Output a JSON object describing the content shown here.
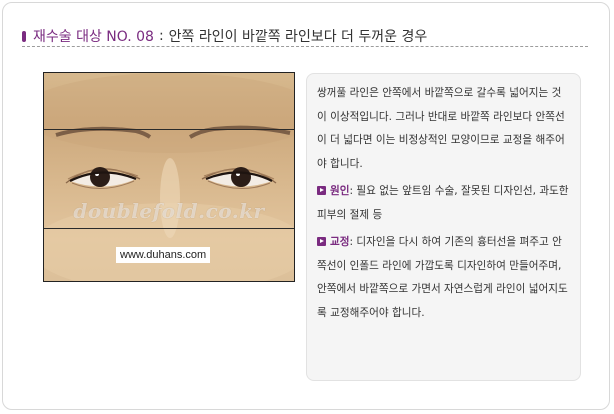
{
  "title": {
    "prefix": "재수술 대상 NO. 08",
    "separator": ":",
    "main": "안쪽 라인이 바깥쪽 라인보다 더 두꺼운 경우"
  },
  "photo": {
    "watermark": "doublefold.co.kr",
    "url": "www.duhans.com"
  },
  "description": {
    "intro": "쌍꺼풀 라인은 안쪽에서 바깥쪽으로 갈수록 넓어지는 것이 이상적입니다. 그러나 반대로 바깥쪽 라인보다 안쪽선이 더 넓다면 이는 비정상적인 모양이므로 교정을 해주어야 합니다.",
    "cause_label": "원인",
    "cause_text": ": 필요 없는 앞트임 수술, 잘못된 디자인선, 과도한 피부의 절제 등",
    "fix_label": "교정",
    "fix_text": ": 디자인을 다시 하여 기존의 흉터선을 펴주고 안쪽선이 인폴드 라인에 가깝도록 디자인하여 만들어주며, 안쪽에서 바깥쪽으로 가면서 자연스럽게 라인이 넓어지도록 교정해주어야 합니다."
  },
  "colors": {
    "accent": "#7a2b80",
    "text": "#333333",
    "box_bg": "#f5f5f5"
  }
}
